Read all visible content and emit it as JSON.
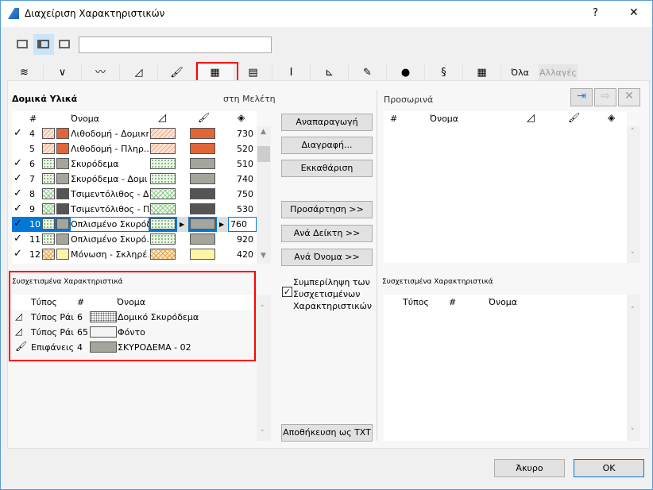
{
  "window": {
    "title": "Διαχείριση Χαρακτηριστικών",
    "help": "?",
    "close": "✕"
  },
  "toolbar": {
    "views": [
      "view-list-icon",
      "view-split-icon",
      "view-details-icon"
    ],
    "search_value": "",
    "search_placeholder": ""
  },
  "tabs": [
    {
      "icon": "layers-icon",
      "glyph": "≋"
    },
    {
      "icon": "pen-icon",
      "glyph": "∨"
    },
    {
      "icon": "line-type-icon",
      "glyph": "〰"
    },
    {
      "icon": "fill-icon",
      "glyph": "◿"
    },
    {
      "icon": "surface-brush-icon",
      "glyph": "🖌"
    },
    {
      "icon": "building-material-icon",
      "glyph": "▦",
      "selected": true
    },
    {
      "icon": "composite-icon",
      "glyph": "▤"
    },
    {
      "icon": "profile-icon",
      "glyph": "I"
    },
    {
      "icon": "zone-icon",
      "glyph": "⊾"
    },
    {
      "icon": "markup-icon",
      "glyph": "✎"
    },
    {
      "icon": "globe-icon",
      "glyph": "●"
    },
    {
      "icon": "mep-icon",
      "glyph": "§"
    },
    {
      "icon": "grid-icon",
      "glyph": "▦"
    },
    {
      "label": "Όλα"
    },
    {
      "label": "Αλλαγές",
      "disabled": true
    }
  ],
  "left": {
    "title": "Δομικά Υλικά",
    "subtitle": "στη Μελέτη",
    "columns": {
      "num": "#",
      "name": "Όνομα"
    },
    "rows": [
      {
        "checked": true,
        "num": "4",
        "name": "Λιθοδομή - Δομική",
        "pattern": "hatch",
        "color": "#e0663a",
        "value": "730"
      },
      {
        "checked": false,
        "num": "5",
        "name": "Λιθοδομή - Πληρ...",
        "pattern": "hatch",
        "color": "#e0663a",
        "value": "520"
      },
      {
        "checked": true,
        "num": "6",
        "name": "Σκυρόδεμα",
        "pattern": "dots",
        "color": "#a5a59c",
        "value": "510"
      },
      {
        "checked": true,
        "num": "7",
        "name": "Σκυρόδεμα - Δομι",
        "pattern": "dots",
        "color": "#a5a59c",
        "value": "740"
      },
      {
        "checked": true,
        "num": "8",
        "name": "Τσιμεντόλιθος - Δ...",
        "pattern": "cross",
        "color": "#555555",
        "value": "750"
      },
      {
        "checked": true,
        "num": "9",
        "name": "Τσιμεντόλιθος - Π...",
        "pattern": "cross",
        "color": "#555555",
        "value": "530"
      },
      {
        "checked": true,
        "num": "10",
        "name": "Οπλισμένο Σκυρόδε",
        "pattern": "dots",
        "color": "#a5a59c",
        "value": "760",
        "selected": true
      },
      {
        "checked": true,
        "num": "11",
        "name": "Οπλισμένο Σκυρό...",
        "pattern": "dots",
        "color": "#a5a59c",
        "value": "920"
      },
      {
        "checked": true,
        "num": "12",
        "name": "Μόνωση - Σκληρέ...",
        "pattern": "insul",
        "color": "#fdf5a6",
        "value": "420"
      }
    ]
  },
  "related_left": {
    "title": "Συσχετισμένα Χαρακτηριστικά",
    "columns": {
      "type": "Τύπος",
      "num": "#",
      "name": "Όνομα"
    },
    "rows": [
      {
        "icon": "fill-icon",
        "type": "Τύπος Ράι",
        "num": "6",
        "name": "Δομικό Σκυρόδεμα",
        "swatch": "gdots"
      },
      {
        "icon": "fill-icon",
        "type": "Τύπος Ράι",
        "num": "65",
        "name": "Φόντο",
        "swatch": "#f4f4f4"
      },
      {
        "icon": "surface-brush-icon",
        "type": "Επιφάνεις",
        "num": "4",
        "name": "ΣΚΥΡΟΔΕΜΑ - 02",
        "swatch": "#a5a59c"
      }
    ]
  },
  "middle": {
    "duplicate": "Αναπαραγωγή",
    "delete": "Διαγραφή...",
    "purge": "Εκκαθάριση",
    "append": "Προσάρτηση >>",
    "by_index": "Ανά Δείκτη >>",
    "by_name": "Ανά Όνομα >>",
    "include_related": [
      "Συμπερίληψη των",
      "Συσχετισμένων",
      "Χαρακτηριστικών"
    ],
    "include_related_checked": true,
    "save_txt": "Αποθήκευση ως TXT"
  },
  "right": {
    "title": "Προσωρινά",
    "columns": {
      "num": "#",
      "name": "Όνομα"
    },
    "related_title": "Συσχετισμένα Χαρακτηριστικά",
    "related_columns": {
      "type": "Τύπος",
      "num": "#",
      "name": "Όνομα"
    }
  },
  "footer": {
    "cancel": "Άκυρο",
    "ok": "OK"
  },
  "colors": {
    "selection": "#0078d7",
    "highlight_box": "#ff0000",
    "accent": "#2a7ad5"
  }
}
